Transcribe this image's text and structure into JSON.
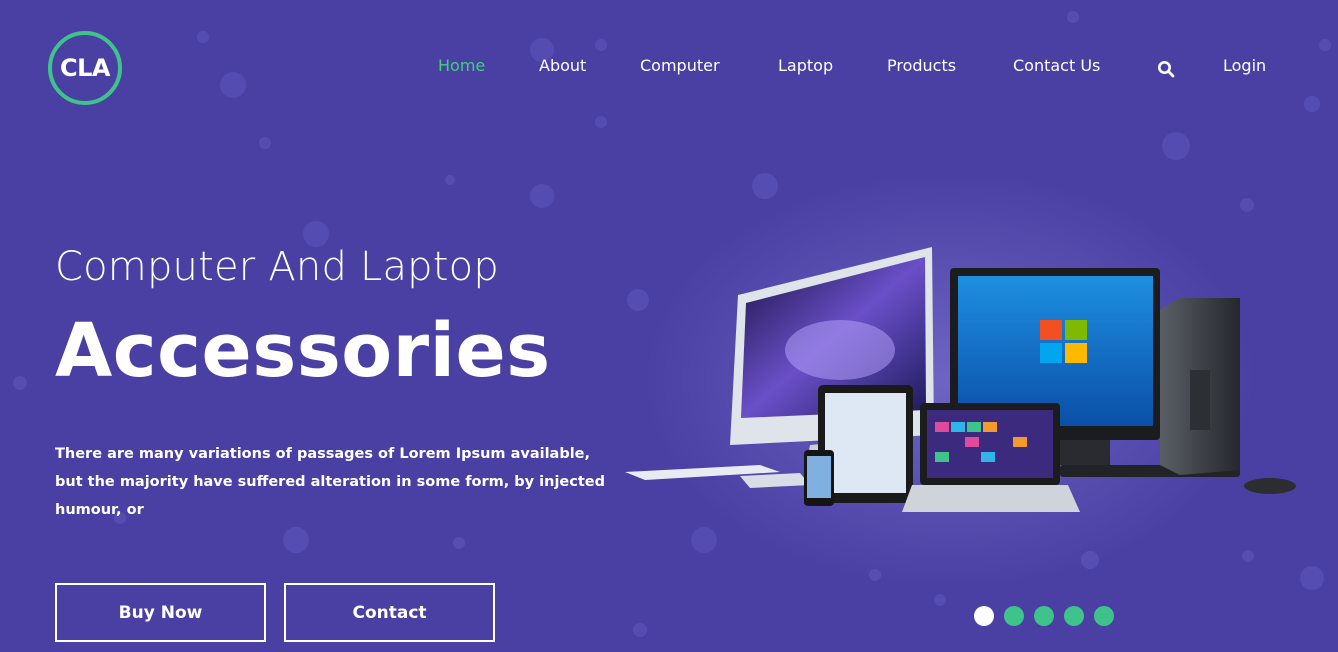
{
  "brand": {
    "logo_text": "CLA",
    "ring_color": "#3ec48b"
  },
  "nav": {
    "items": [
      {
        "label": "Home",
        "active": true
      },
      {
        "label": "About"
      },
      {
        "label": "Computer"
      },
      {
        "label": "Laptop"
      },
      {
        "label": "Products"
      },
      {
        "label": "Contact Us"
      }
    ],
    "search_icon": "search-icon",
    "login_label": "Login",
    "active_color": "#3ed17a"
  },
  "hero": {
    "subtitle": "Computer And Laptop",
    "title": "Accessories",
    "description": "There are many variations of passages of Lorem Ipsum available, but the majority have suffered alteration in some form, by injected humour, or",
    "buttons": {
      "buy_now": "Buy Now",
      "contact": "Contact"
    }
  },
  "carousel": {
    "dot_count": 5,
    "active_index": 0,
    "dot_color": "#3ec48b"
  },
  "colors": {
    "background": "#4a40a4",
    "accent": "#3ec48b"
  }
}
